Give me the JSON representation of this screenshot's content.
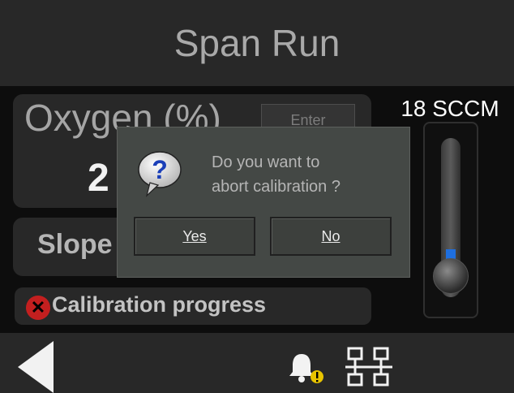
{
  "header": {
    "title": "Span Run"
  },
  "oxygen": {
    "label": "Oxygen (%)",
    "enter_label": "Enter",
    "value_partial": "2"
  },
  "slope": {
    "label_partial": "Slope"
  },
  "progress": {
    "label": "Calibration progress",
    "status_icon": "error-icon"
  },
  "flow": {
    "label": "18 SCCM",
    "level_fraction": 0.18
  },
  "dialog": {
    "icon": "question-icon",
    "message_line1": "Do you want to",
    "message_line2": "abort calibration ?",
    "yes_label": "Yes",
    "no_label": "No"
  },
  "footer": {
    "icons": [
      "back-icon",
      "bell-icon",
      "network-icon"
    ]
  },
  "colors": {
    "accent": "#1e6fe0",
    "error": "#c31f1f",
    "panel": "#282828",
    "dialog_bg": "#444845"
  }
}
